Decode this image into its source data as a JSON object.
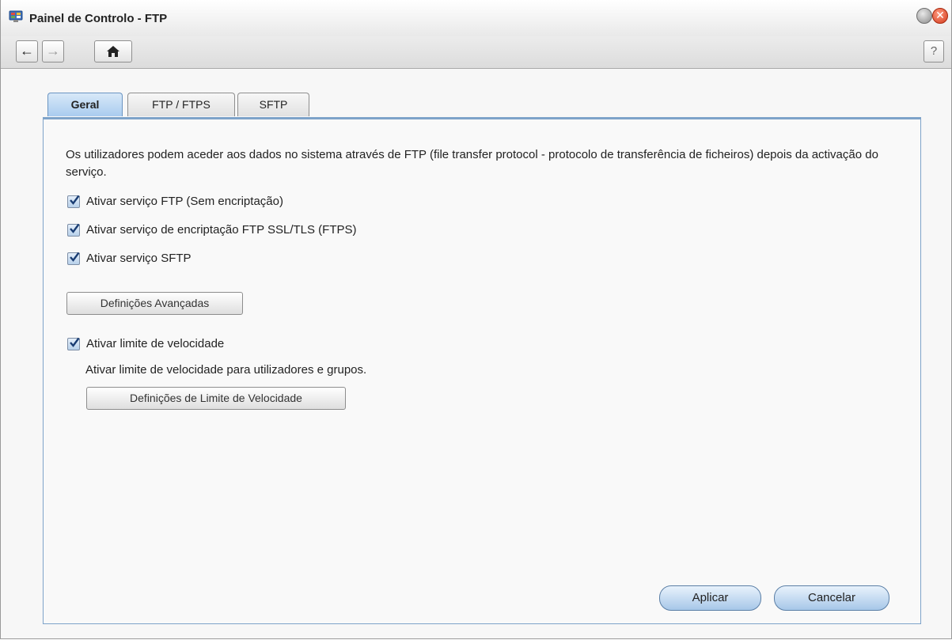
{
  "window": {
    "title": "Painel de Controlo - FTP",
    "icon": "control-panel-icon",
    "close_glyph": "✕"
  },
  "toolbar": {
    "back_icon": "←",
    "forward_icon": "→",
    "home_icon": "home-icon",
    "help_label": "?"
  },
  "tabs": [
    {
      "label": "Geral",
      "active": true
    },
    {
      "label": "FTP / FTPS",
      "active": false
    },
    {
      "label": "SFTP",
      "active": false
    }
  ],
  "general": {
    "description": "Os utilizadores podem aceder aos dados no sistema através de FTP (file transfer protocol - protocolo de transferência de ficheiros) depois da activação do serviço.",
    "options": [
      {
        "label": "Ativar serviço FTP (Sem encriptação)",
        "checked": true
      },
      {
        "label": "Ativar serviço de encriptação FTP SSL/TLS (FTPS)",
        "checked": true
      },
      {
        "label": "Ativar serviço SFTP",
        "checked": true
      }
    ],
    "advanced_button": "Definições Avançadas",
    "speed_limit": {
      "label": "Ativar limite de velocidade",
      "checked": true,
      "description": "Ativar limite de velocidade para utilizadores e grupos.",
      "button": "Definições de Limite de Velocidade"
    }
  },
  "footer": {
    "apply": "Aplicar",
    "cancel": "Cancelar"
  },
  "colors": {
    "accent": "#a9ccef",
    "panel_border": "#7ea3c9"
  }
}
